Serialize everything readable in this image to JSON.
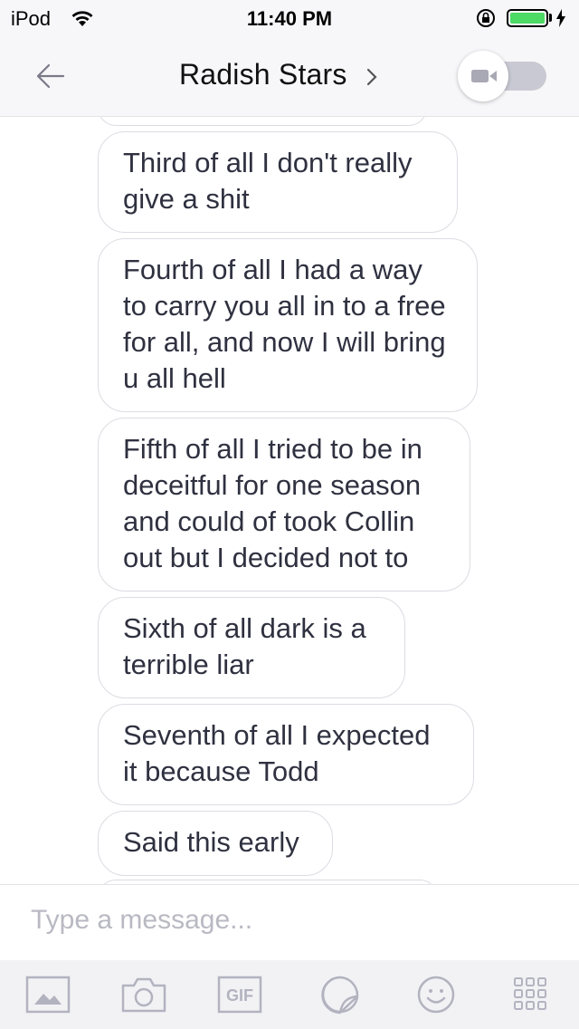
{
  "status_bar": {
    "carrier": "iPod",
    "time": "11:40 PM"
  },
  "header": {
    "title": "Radish Stars",
    "video_toggle": "off"
  },
  "messages": [
    {
      "text": "Third of all I don't really give a shit"
    },
    {
      "text": "Fourth of all I had a way to carry you all in to a free for all, and now I will bring u all hell"
    },
    {
      "text": "Fifth of all I tried to be in deceitful for one season and could of took Collin out but I decided not to"
    },
    {
      "text": "Sixth of all dark is a terrible liar"
    },
    {
      "text": "Seventh of all I expected it because Todd"
    },
    {
      "text": "Said this early"
    }
  ],
  "composer": {
    "placeholder": "Type a message..."
  },
  "toolbar": {
    "gif_label": "GIF",
    "icons": [
      "image-icon",
      "camera-icon",
      "gif-icon",
      "sticker-icon",
      "emoji-icon",
      "grid-icon"
    ]
  },
  "colors": {
    "accent": "#4cd964",
    "bubble_border": "#dcdce3",
    "icon_gray": "#b3b3c0"
  }
}
